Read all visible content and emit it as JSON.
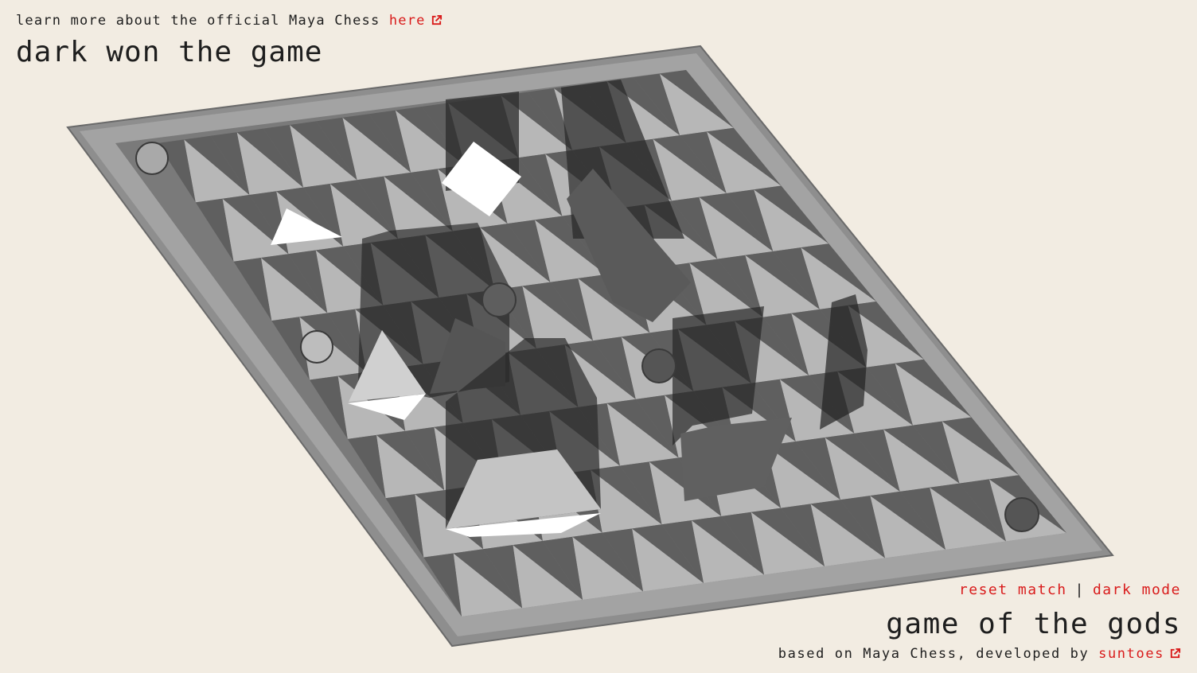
{
  "header": {
    "learn_prefix": "learn more about the official Maya Chess",
    "learn_link": "here",
    "status": "dark won the game"
  },
  "controls": {
    "reset": "reset match",
    "separator": "|",
    "dark_mode": "dark mode"
  },
  "footer": {
    "title": "game of the gods",
    "credit_prefix": "based on Maya Chess, developed by",
    "credit_link": "suntoes"
  },
  "colors": {
    "background": "#f2ece2",
    "link": "#d91b1b",
    "text": "#1e1e1e",
    "board_frame": "#8c8c8c",
    "light_triangle": "#b7b7b7",
    "dark_triangle": "#5f5f5f",
    "dark_piece": "#2a2a2a",
    "light_piece": "#ffffff"
  },
  "board": {
    "rows": 8,
    "cols": 10
  },
  "icons": {
    "external_link": "external-link-icon"
  }
}
